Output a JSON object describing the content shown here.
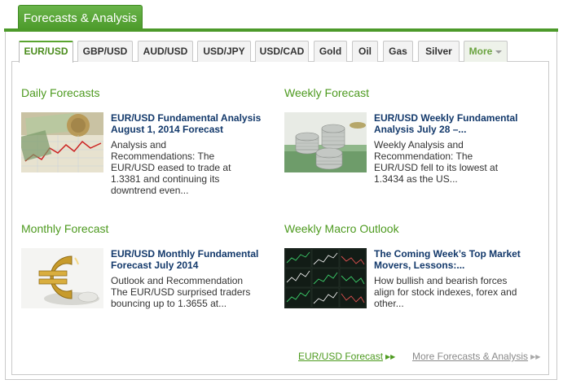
{
  "header": {
    "title": "Forecasts & Analysis"
  },
  "tabs": [
    {
      "label": "EUR/USD",
      "active": true
    },
    {
      "label": "GBP/USD",
      "active": false
    },
    {
      "label": "AUD/USD",
      "active": false
    },
    {
      "label": "USD/JPY",
      "active": false
    },
    {
      "label": "USD/CAD",
      "active": false
    },
    {
      "label": "Gold",
      "active": false
    },
    {
      "label": "Oil",
      "active": false
    },
    {
      "label": "Gas",
      "active": false
    },
    {
      "label": "Silver",
      "active": false
    },
    {
      "label": "More",
      "active": false
    }
  ],
  "sections": {
    "daily": {
      "title": "Daily Forecasts",
      "article_title_1": "EUR/USD Fundamental Analysis",
      "article_title_2": "August 1, 2014 Forecast",
      "body": [
        "Analysis and",
        "Recommendations: The",
        "EUR/USD eased to trade at",
        "1.3381 and continuing its",
        "downtrend even..."
      ]
    },
    "weekly": {
      "title": "Weekly Forecast",
      "article_title_1": "EUR/USD Weekly Fundamental",
      "article_title_2": "Analysis July 28 –...",
      "body": [
        "Weekly Analysis and",
        "Recommendation: The",
        "EUR/USD fell to its lowest at",
        "1.3434 as the US..."
      ]
    },
    "monthly": {
      "title": "Monthly Forecast",
      "article_title_1": "EUR/USD Monthly Fundamental",
      "article_title_2": "Forecast July 2014",
      "body": [
        "Outlook and Recommendation",
        "The EUR/USD surprised traders",
        "bouncing up to 1.3655 at..."
      ]
    },
    "macro": {
      "title": "Weekly Macro Outlook",
      "article_title_1": "The Coming Week’s Top Market",
      "article_title_2": "Movers, Lessons:...",
      "body": [
        "How bullish and bearish forces",
        "align for stock indexes, forex and",
        "other..."
      ]
    }
  },
  "footer": {
    "forecast_link": "EUR/USD Forecast",
    "more_link": "More Forecasts & Analysis"
  },
  "colors": {
    "accent_green": "#4d9a1f",
    "link_navy": "#13396b",
    "muted_gray": "#8a8a8a"
  }
}
